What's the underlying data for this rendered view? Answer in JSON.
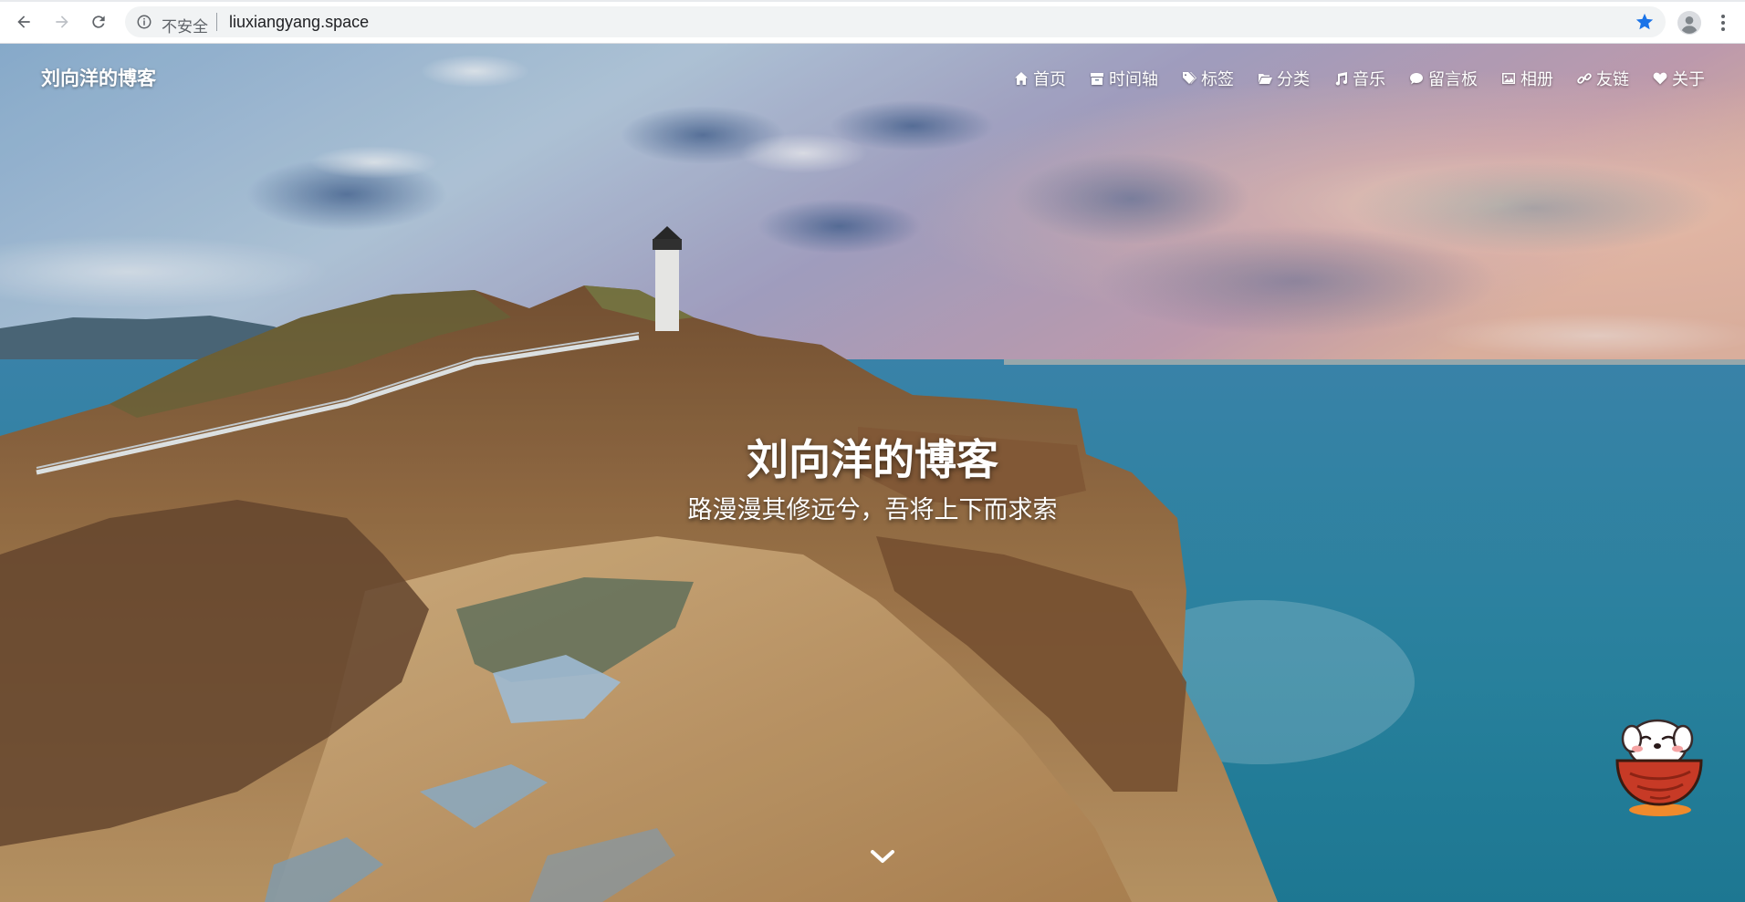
{
  "browser": {
    "security_label": "不安全",
    "url": "liuxiangyang.space",
    "icons": [
      "back-arrow-icon",
      "forward-arrow-icon",
      "reload-icon",
      "info-icon",
      "star-icon",
      "profile-icon",
      "kebab-menu-icon"
    ],
    "accent_color": "#1a73e8"
  },
  "site": {
    "brand": "刘向洋的博客",
    "nav": [
      {
        "label": "首页",
        "icon": "home-icon"
      },
      {
        "label": "时间轴",
        "icon": "archive-icon"
      },
      {
        "label": "标签",
        "icon": "tags-icon"
      },
      {
        "label": "分类",
        "icon": "folder-icon"
      },
      {
        "label": "音乐",
        "icon": "music-icon"
      },
      {
        "label": "留言板",
        "icon": "comment-icon"
      },
      {
        "label": "相册",
        "icon": "picture-icon"
      },
      {
        "label": "友链",
        "icon": "link-icon"
      },
      {
        "label": "关于",
        "icon": "heart-icon"
      }
    ]
  },
  "hero": {
    "title": "刘向洋的博客",
    "subtitle": "路漫漫其修远兮，吾将上下而求索",
    "scroll_icon": "chevron-down-icon",
    "mascot_icon": "dog-in-bowl-mascot-icon"
  }
}
